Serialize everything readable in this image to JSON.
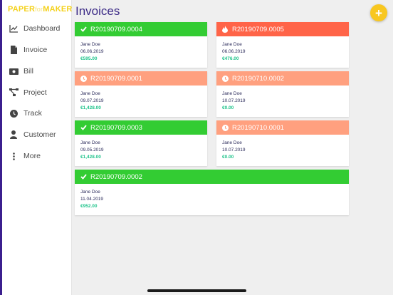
{
  "app": {
    "logo_part1": "PAPER",
    "logo_part2": "for",
    "logo_part3": "MAKER"
  },
  "nav": [
    {
      "label": "Dashboard",
      "icon": "chart-line-icon"
    },
    {
      "label": "Invoice",
      "icon": "document-icon"
    },
    {
      "label": "Bill",
      "icon": "money-icon"
    },
    {
      "label": "Project",
      "icon": "hierarchy-icon"
    },
    {
      "label": "Track",
      "icon": "clock-icon"
    },
    {
      "label": "Customer",
      "icon": "user-icon"
    },
    {
      "label": "More",
      "icon": "more-vertical-icon"
    }
  ],
  "page": {
    "title": "Invoices",
    "add_label": "+"
  },
  "colors": {
    "paid": "#33cc33",
    "overdue": "#ff6448",
    "pending": "#ffa07f",
    "accent": "#f8c720",
    "amount": "#21c48c",
    "title": "#3b2a86"
  },
  "invoices": [
    {
      "number": "R20190709.0004",
      "status": "paid",
      "status_icon": "check-icon",
      "customer": "Jane Doe",
      "date": "06.06.2019",
      "amount": "€595.00"
    },
    {
      "number": "R20190709.0005",
      "status": "overdue",
      "status_icon": "fire-icon",
      "customer": "Jane Doe",
      "date": "06.06.2019",
      "amount": "€476.00"
    },
    {
      "number": "R20190709.0001",
      "status": "pending",
      "status_icon": "clock-icon",
      "customer": "Jane Doe",
      "date": "09.07.2019",
      "amount": "€1,428.00"
    },
    {
      "number": "R20190710.0002",
      "status": "pending",
      "status_icon": "clock-icon",
      "customer": "Jane Doe",
      "date": "10.07.2019",
      "amount": "€0.00"
    },
    {
      "number": "R20190709.0003",
      "status": "paid",
      "status_icon": "check-icon",
      "customer": "Jane Doe",
      "date": "09.05.2019",
      "amount": "€1,428.00"
    },
    {
      "number": "R20190710.0001",
      "status": "pending",
      "status_icon": "clock-icon",
      "customer": "Jane Doe",
      "date": "10.07.2019",
      "amount": "€0.00"
    },
    {
      "number": "R20190709.0002",
      "status": "paid",
      "status_icon": "check-icon",
      "customer": "Jane Doe",
      "date": "11.04.2019",
      "amount": "€952.00"
    }
  ]
}
